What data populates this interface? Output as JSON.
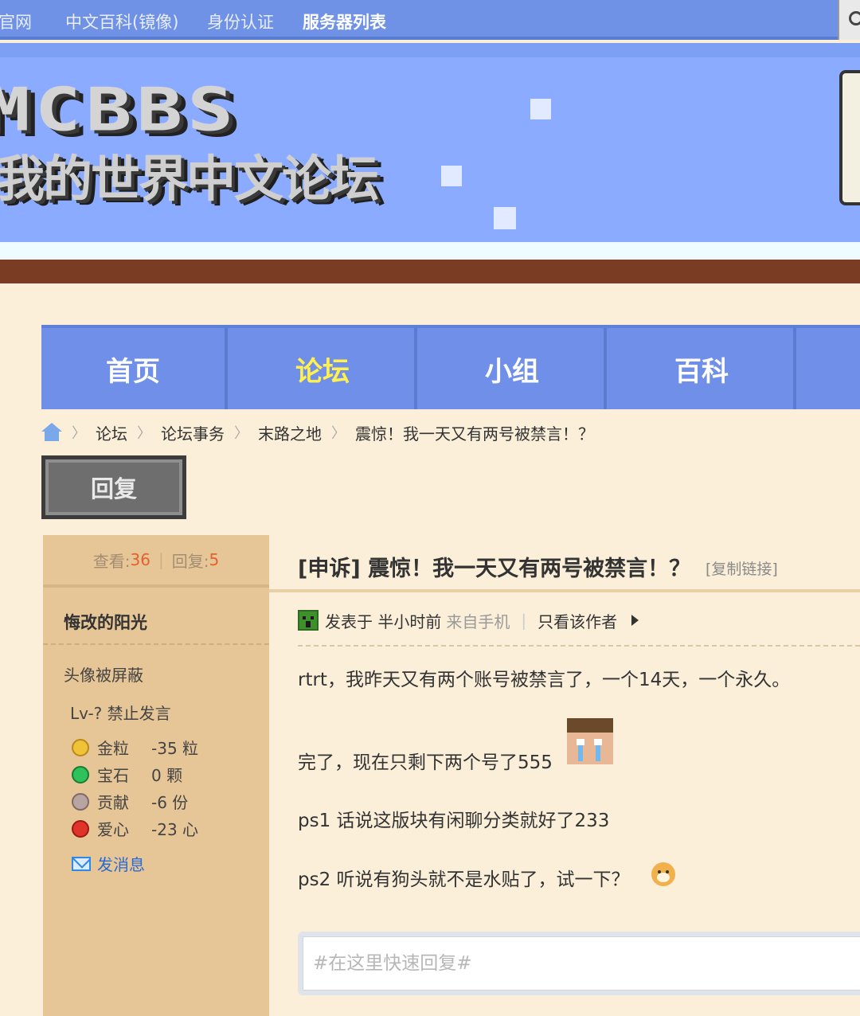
{
  "top_nav": {
    "links": [
      "官网",
      "中文百科(镜像)",
      "身份认证",
      "服务器列表"
    ]
  },
  "banner": {
    "logo_text": "MCBBS",
    "logo_subtitle": "我的世界中文论坛"
  },
  "main_nav": {
    "tabs": [
      "首页",
      "论坛",
      "小组",
      "百科"
    ],
    "active": "论坛"
  },
  "breadcrumb": {
    "items": [
      "论坛",
      "论坛事务",
      "末路之地",
      "震惊！我一天又有两号被禁言！？"
    ],
    "separator": "〉"
  },
  "reply_button": "回复",
  "stats": {
    "views_label": "查看:",
    "views": "36",
    "replies_label": "回复:",
    "replies": "5"
  },
  "author": {
    "name": "悔改的阳光",
    "avatar_status": "头像被屏蔽",
    "level": "Lv-? 禁止发言",
    "items": [
      {
        "label": "金粒",
        "value": "-35 粒",
        "icon": "gold-nugget-icon",
        "color": "#f0c23a"
      },
      {
        "label": "宝石",
        "value": "0 颗",
        "icon": "emerald-icon",
        "color": "#2fc25a"
      },
      {
        "label": "贡献",
        "value": "-6 份",
        "icon": "contribution-icon",
        "color": "#b8a4a0"
      },
      {
        "label": "爱心",
        "value": "-23 心",
        "icon": "apple-icon",
        "color": "#e0332a"
      }
    ],
    "message_link": "发消息"
  },
  "post": {
    "title": "[申诉] 震惊！我一天又有两号被禁言！？",
    "copy_link": "[复制链接]",
    "meta_posted": "发表于 半小时前",
    "meta_source": "来自手机",
    "meta_author_only": "只看该作者",
    "paragraphs": [
      "rtrt，我昨天又有两个账号被禁言了，一个14天，一个永久。",
      "完了，现在只剩下两个号了555",
      "ps1 话说这版块有闲聊分类就好了233",
      "ps2 听说有狗头就不是水贴了，试一下？"
    ]
  },
  "quick_reply": {
    "placeholder": "#在这里快速回复#"
  },
  "colors": {
    "nav_blue": "#6f8fe8",
    "active_tab": "#ffef4f",
    "page_bg": "#fbefd9",
    "sidebar_bg": "#e6c596",
    "stat_number": "#e4622f"
  }
}
